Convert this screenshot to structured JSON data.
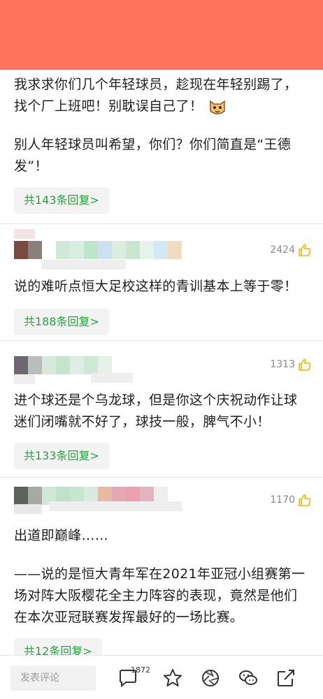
{
  "comments": [
    {
      "para1": "我求求你们几个年轻球员，趁现在年轻别踢了，找个厂上班吧！别耽误自己了！",
      "para2": "别人年轻球员叫希望，你们？你们简直是“王德发”！",
      "reply": "共143条回复>"
    },
    {
      "likes": "2424",
      "text": "说的难听点恒大足校这样的青训基本上等于零！",
      "reply": "共188条回复>"
    },
    {
      "likes": "1313",
      "text": "进个球还是个乌龙球，但是你这个庆祝动作让球迷们闭嘴就不好了，球技一般，脾气不小！",
      "reply": "共133条回复>"
    },
    {
      "likes": "1170",
      "para1": "出道即巅峰……",
      "para2": "——说的是恒大青年军在2021年亚冠小组赛第一场对阵大阪樱花全主力阵容的表现，竟然是他们在本次亚冠联赛发挥最好的一场比赛。",
      "reply": "共12条回复>"
    }
  ],
  "bottom_bar": {
    "input_placeholder": "发表评论",
    "comment_count": "1872",
    "icons": [
      "comment-icon",
      "star-icon",
      "aperture-icon",
      "wechat-icon",
      "share-icon"
    ]
  },
  "colors": {
    "status_bar": "#ff735c",
    "reply_text": "#2e9e43",
    "like_icon": "#f4b400"
  }
}
